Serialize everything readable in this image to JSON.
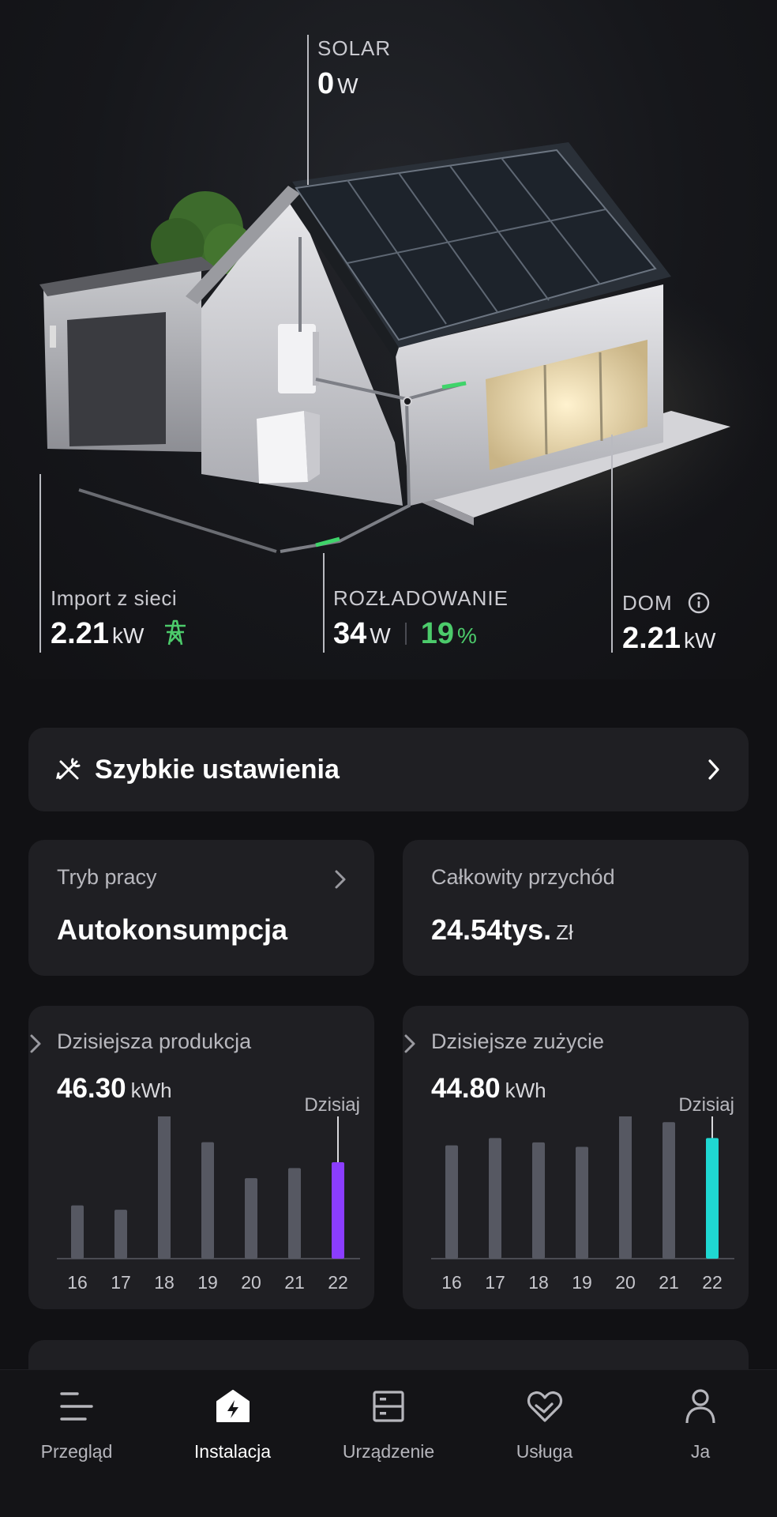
{
  "hero": {
    "solar": {
      "label": "SOLAR",
      "value": "0",
      "unit": "W"
    },
    "grid": {
      "label": "Import z sieci",
      "value": "2.21",
      "unit": "kW",
      "icon": "grid-tower-icon"
    },
    "battery": {
      "label": "ROZŁADOWANIE",
      "value": "34",
      "unit": "W",
      "soc": "19",
      "soc_unit": "%"
    },
    "home": {
      "label": "DOM",
      "value": "2.21",
      "unit": "kW",
      "icon": "info-icon"
    }
  },
  "quick_settings": {
    "title": "Szybkie ustawienia",
    "icon": "tools-icon"
  },
  "mode_card": {
    "label": "Tryb pracy",
    "value": "Autokonsumpcja"
  },
  "revenue_card": {
    "label": "Całkowity przychód",
    "value": "24.54tys.",
    "unit": "Zł"
  },
  "production_card": {
    "label": "Dzisiejsza produkcja",
    "value": "46.30",
    "unit": "kWh",
    "today_label": "Dzisiaj"
  },
  "consumption_card": {
    "label": "Dzisiejsze zużycie",
    "value": "44.80",
    "unit": "kWh",
    "today_label": "Dzisiaj"
  },
  "chart_data": [
    {
      "type": "bar",
      "categories": [
        "16",
        "17",
        "18",
        "19",
        "20",
        "21",
        "22"
      ],
      "values": [
        37,
        34,
        100,
        81,
        56,
        63,
        67
      ],
      "highlight_index": 6,
      "highlight_color": "#8b3dff",
      "bar_color": "#565862"
    },
    {
      "type": "bar",
      "categories": [
        "16",
        "17",
        "18",
        "19",
        "20",
        "21",
        "22"
      ],
      "values": [
        78,
        83,
        80,
        77,
        99,
        94,
        83
      ],
      "highlight_index": 6,
      "highlight_color": "#1fd8d2",
      "bar_color": "#565862"
    }
  ],
  "nav": {
    "items": [
      {
        "label": "Przegląd",
        "icon": "overview-icon",
        "active": false
      },
      {
        "label": "Instalacja",
        "icon": "installation-icon",
        "active": true
      },
      {
        "label": "Urządzenie",
        "icon": "device-icon",
        "active": false
      },
      {
        "label": "Usługa",
        "icon": "service-icon",
        "active": false
      },
      {
        "label": "Ja",
        "icon": "profile-icon",
        "active": false
      }
    ]
  },
  "colors": {
    "green": "#4ccb6b",
    "card": "#1f1f23",
    "bg": "#111114"
  }
}
